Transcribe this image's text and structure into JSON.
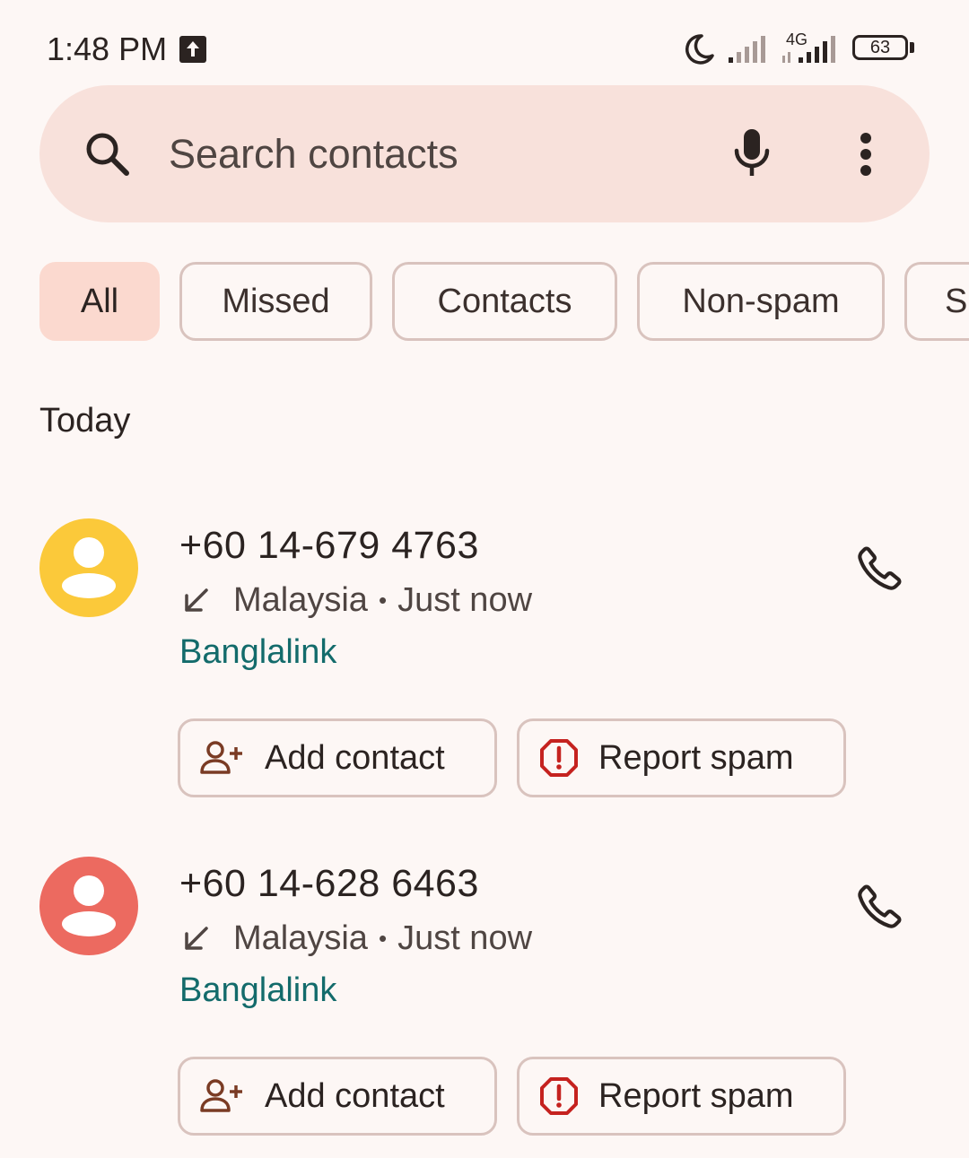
{
  "status_bar": {
    "time": "1:48 PM",
    "network_type": "4G",
    "battery": "63"
  },
  "search": {
    "placeholder": "Search contacts"
  },
  "filters": [
    {
      "label": "All",
      "active": true
    },
    {
      "label": "Missed",
      "active": false
    },
    {
      "label": "Contacts",
      "active": false
    },
    {
      "label": "Non-spam",
      "active": false
    },
    {
      "label": "Sp",
      "active": false
    }
  ],
  "section_header": "Today",
  "calls": [
    {
      "number": "+60 14-679 4763",
      "location": "Malaysia",
      "separator": "•",
      "time": "Just now",
      "carrier": "Banglalink",
      "avatar_color": "#fbc93a",
      "add_label": "Add contact",
      "spam_label": "Report spam"
    },
    {
      "number": "+60 14-628 6463",
      "location": "Malaysia",
      "separator": "•",
      "time": "Just now",
      "carrier": "Banglalink",
      "avatar_color": "#ec6a60",
      "add_label": "Add contact",
      "spam_label": "Report spam"
    }
  ],
  "colors": {
    "background": "#fdf7f5",
    "search_bg": "#f8e1db",
    "active_chip": "#fbd9cf",
    "carrier_text": "#136b6b",
    "spam_red": "#c5221f"
  }
}
